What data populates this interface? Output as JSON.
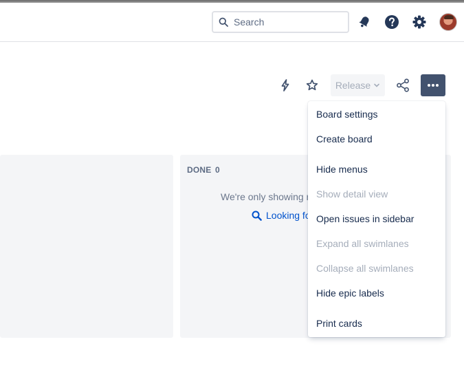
{
  "header": {
    "search_placeholder": "Search",
    "icons": [
      "search-icon",
      "notification-icon",
      "help-icon",
      "settings-icon",
      "avatar"
    ]
  },
  "toolbar": {
    "release_label": "Release",
    "icons": [
      "lightning-icon",
      "star-icon",
      "share-icon",
      "more-icon"
    ]
  },
  "board": {
    "done_column": {
      "title": "DONE",
      "count": "0",
      "message": "We're only showing r",
      "link": "Looking fo"
    }
  },
  "menu": {
    "items": [
      {
        "label": "Board settings",
        "enabled": true
      },
      {
        "label": "Create board",
        "enabled": true
      },
      {
        "label": "Hide menus",
        "enabled": true
      },
      {
        "label": "Show detail view",
        "enabled": false
      },
      {
        "label": "Open issues in sidebar",
        "enabled": true
      },
      {
        "label": "Expand all swimlanes",
        "enabled": false
      },
      {
        "label": "Collapse all swimlanes",
        "enabled": false
      },
      {
        "label": "Hide epic labels",
        "enabled": true
      },
      {
        "label": "Print cards",
        "enabled": true
      }
    ]
  },
  "colors": {
    "primary_text": "#172b4d",
    "disabled_text": "#a5adba",
    "link": "#0052cc",
    "column_bg": "#f4f5f7",
    "more_button_bg": "#42526e"
  }
}
